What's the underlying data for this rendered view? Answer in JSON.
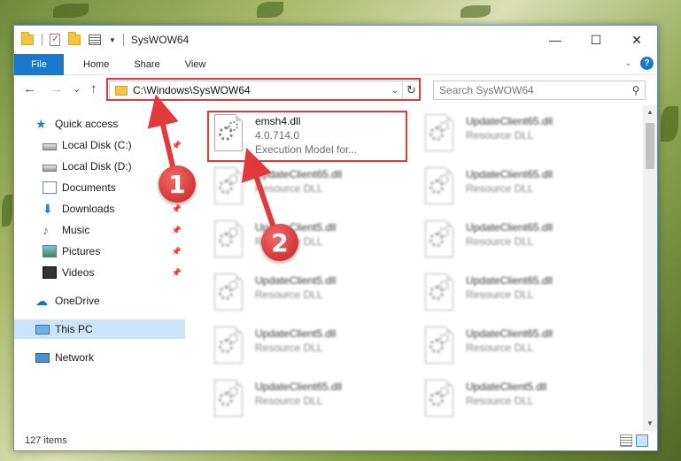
{
  "window": {
    "title": "SysWOW64"
  },
  "titlebar": {
    "minimize_icon": "minimize-icon",
    "maximize_icon": "maximize-icon",
    "close_icon": "close-icon",
    "minimize_glyph": "—",
    "maximize_glyph": "☐",
    "close_glyph": "✕"
  },
  "ribbon": {
    "tabs": [
      "File",
      "Home",
      "Share",
      "View"
    ],
    "help_glyph": "?",
    "collapse_glyph": "⌄"
  },
  "navigation": {
    "back_glyph": "←",
    "forward_glyph": "→",
    "recent_glyph": "⌄",
    "up_glyph": "↑",
    "address": "C:\\Windows\\SysWOW64",
    "address_dropdown_glyph": "⌄",
    "refresh_glyph": "↻",
    "search_placeholder": "Search SysWOW64",
    "search_glyph": "⚲"
  },
  "sidebar": {
    "items": [
      {
        "label": "Quick access",
        "icon": "star-icon"
      },
      {
        "label": "Local Disk (C:)",
        "icon": "disk-icon",
        "pinned": true
      },
      {
        "label": "Local Disk (D:)",
        "icon": "disk-icon",
        "pinned": false
      },
      {
        "label": "Documents",
        "icon": "documents-icon",
        "pinned": false
      },
      {
        "label": "Downloads",
        "icon": "downloads-icon",
        "pinned": true
      },
      {
        "label": "Music",
        "icon": "music-icon",
        "pinned": true
      },
      {
        "label": "Pictures",
        "icon": "pictures-icon",
        "pinned": true
      },
      {
        "label": "Videos",
        "icon": "videos-icon",
        "pinned": true
      },
      {
        "label": "OneDrive",
        "icon": "cloud-icon"
      },
      {
        "label": "This PC",
        "icon": "computer-icon",
        "selected": true
      },
      {
        "label": "Network",
        "icon": "network-icon"
      }
    ]
  },
  "files": {
    "highlighted": {
      "name": "emsh4.dll",
      "version": "4.0.714.0",
      "description": "Execution Model for..."
    },
    "others": [
      {
        "name": "UpdateClient65.dll",
        "type": "Resource DLL"
      },
      {
        "name": "UpdateClient65.dll",
        "type": "Resource DLL"
      },
      {
        "name": "UpdateClient65.dll",
        "type": "Resource DLL"
      },
      {
        "name": "UpdateClient5.dll",
        "type": "Resource DLL"
      },
      {
        "name": "UpdateClient65.dll",
        "type": "Resource DLL"
      },
      {
        "name": "UpdateClient5.dll",
        "type": "Resource DLL"
      },
      {
        "name": "UpdateClient65.dll",
        "type": "Resource DLL"
      },
      {
        "name": "UpdateClient5.dll",
        "type": "Resource DLL"
      },
      {
        "name": "UpdateClient65.dll",
        "type": "Resource DLL"
      },
      {
        "name": "UpdateClient65.dll",
        "type": "Resource DLL"
      },
      {
        "name": "UpdateClient5.dll",
        "type": "Resource DLL"
      }
    ]
  },
  "status": {
    "item_count": "127 items"
  },
  "annotations": {
    "step1": "1",
    "step2": "2",
    "highlight_color": "#e03a3a"
  },
  "colors": {
    "accent": "#1979ca",
    "selected": "#cce4f7"
  }
}
